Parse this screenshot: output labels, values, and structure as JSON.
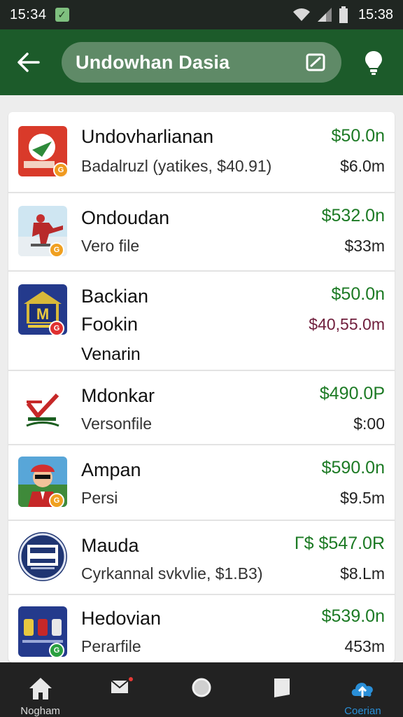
{
  "status_bar": {
    "time_left": "15:34",
    "notification_icon": "check-box-icon",
    "time_right": "15:38"
  },
  "app_bar": {
    "back_icon": "arrow-left-icon",
    "search_text": "Undowhan Dasia",
    "edit_icon": "edit-square-icon",
    "bulb_icon": "lightbulb-icon"
  },
  "list": [
    {
      "title": "Undovharlianan",
      "subtitle": "Badalruzl (yatikes, $40.91)",
      "price": "$50.0n",
      "amount": "$6.0m",
      "badge_color": "#f09a20",
      "icon_bg": "#d93a2a"
    },
    {
      "title": "Ondoudan",
      "subtitle": "Vero file",
      "price": "$532.0n",
      "amount": "$33m",
      "badge_color": "#f0a020",
      "icon_bg": "#cfe6f2"
    },
    {
      "title": "Backian",
      "title2": "Fookin",
      "subtitle": "Venarin",
      "price": "$50.0n",
      "amount": "$40,55.0m",
      "badge_color": "#e03030",
      "icon_bg": "#243a8c"
    },
    {
      "title": "Mdonkar",
      "subtitle": "Versonfile",
      "price": "$490.0P",
      "amount": "$:00",
      "icon_bg": "#ffffff"
    },
    {
      "title": "Ampan",
      "subtitle": "Persi",
      "price": "$590.0n",
      "amount": "$9.5m",
      "badge_color": "#f0a020",
      "icon_bg": "#58a6d8"
    },
    {
      "title": "Mauda",
      "subtitle": "Cyrkannal svkvlie, $1.B3)",
      "price": "Γ$ $547.0R",
      "amount": "$8.Lm",
      "icon_bg": "#1f3572"
    },
    {
      "title": "Hedovian",
      "subtitle": "Perarfile",
      "price": "$539.0n",
      "amount": "453m",
      "badge_color": "#2aa040",
      "icon_bg": "#243a8c"
    }
  ],
  "nav": [
    {
      "label": "Nogham",
      "icon": "home-icon"
    },
    {
      "label": "",
      "icon": "mail-icon"
    },
    {
      "label": "",
      "icon": "circle-icon"
    },
    {
      "label": "",
      "icon": "square-icon"
    },
    {
      "label": "Coerian",
      "icon": "cloud-icon"
    }
  ],
  "colors": {
    "appbar": "#1c5b2a",
    "price_green": "#1c7a24",
    "accent_blue": "#2a8fd8",
    "maroon": "#6f1e3c"
  }
}
